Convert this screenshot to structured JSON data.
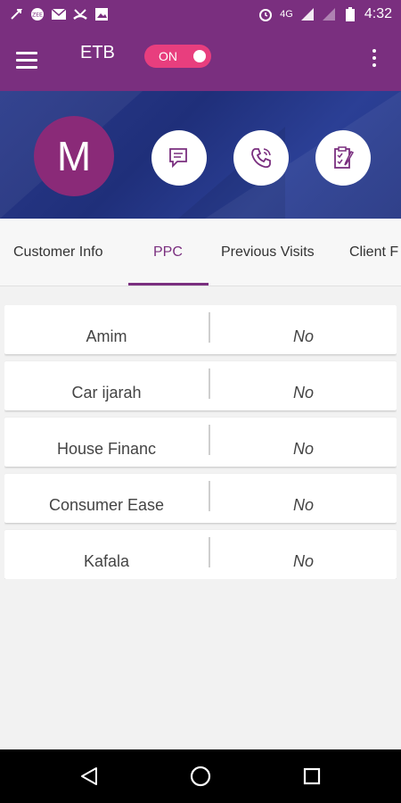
{
  "status_bar": {
    "time": "4:32",
    "network": "4G",
    "left_icons": [
      "navigation-icon",
      "zee-app-icon",
      "mail-icon",
      "missed-call-icon",
      "image-icon"
    ],
    "right_icons": [
      "alarm-icon",
      "signal-icon",
      "signal-icon",
      "battery-icon"
    ]
  },
  "app_bar": {
    "title": "ETB",
    "toggle_label": "ON",
    "menu_icon": "hamburger-icon",
    "overflow_icon": "more-vert-icon"
  },
  "profile": {
    "initial": "M",
    "actions": [
      "chat-icon",
      "phone-icon",
      "clipboard-icon"
    ]
  },
  "tabs": {
    "items": [
      {
        "label": "Customer Info"
      },
      {
        "label": "PPC"
      },
      {
        "label": "Previous Visits"
      },
      {
        "label": "Client F"
      }
    ],
    "active": "PPC"
  },
  "products": [
    {
      "name": "Amim",
      "value": "No"
    },
    {
      "name": "Car ijarah",
      "value": "No"
    },
    {
      "name": "House Financ",
      "value": "No"
    },
    {
      "name": "Consumer Ease",
      "value": "No"
    },
    {
      "name": "Kafala",
      "value": "No"
    }
  ],
  "colors": {
    "primary": "#7a2f7f",
    "accent": "#e83e7e",
    "banner": "#23347f",
    "avatar": "#8a2a78"
  }
}
